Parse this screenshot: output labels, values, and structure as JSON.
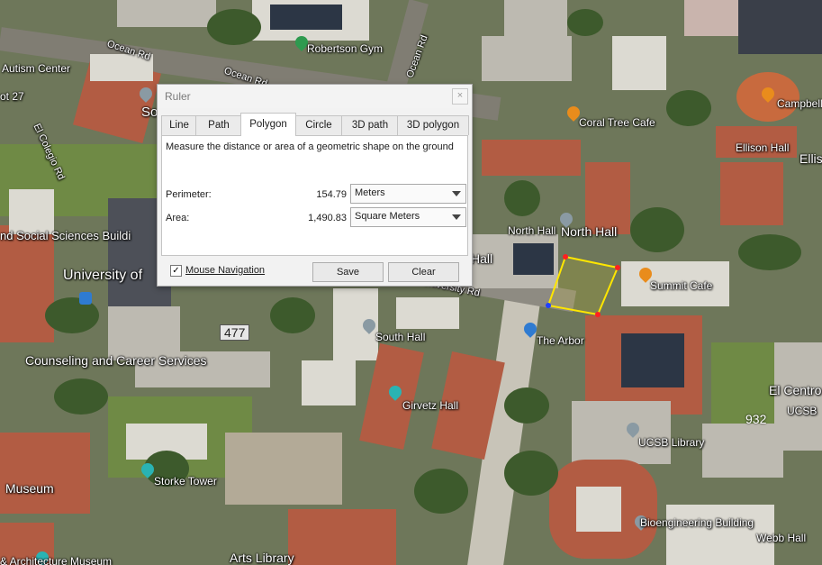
{
  "ruler": {
    "title": "Ruler",
    "close": "×",
    "tabs": [
      "Line",
      "Path",
      "Polygon",
      "Circle",
      "3D path",
      "3D polygon"
    ],
    "active_tab": "Polygon",
    "description": "Measure the distance or area of a geometric shape on the ground",
    "perimeter_label": "Perimeter:",
    "perimeter_value": "154.79",
    "perimeter_unit": "Meters",
    "area_label": "Area:",
    "area_value": "1,490.83",
    "area_unit": "Square Meters",
    "mouse_navigation_label": "Mouse Navigation",
    "mouse_navigation_checked": true,
    "save_label": "Save",
    "clear_label": "Clear"
  },
  "map": {
    "labels": {
      "robertson_gym": "Robertson Gym",
      "autism_center": "Autism Center",
      "ot27": "ot 27",
      "el_colegio": "El Colegio Rd",
      "ocean_rd_1": "Ocean Rd",
      "ocean_rd_2": "Ocean Rd",
      "ocean_rd_3": "Ocean Rd",
      "coral_tree": "Coral Tree Cafe",
      "campbell": "Campbell",
      "ellison": "Ellison Hall",
      "ellis": "Ellis",
      "north_hall_1": "North Hall",
      "north_hall_2": "North Hall",
      "hall": "Hall",
      "social_sciences": "nd Social Sciences Buildi",
      "university_of": "University of",
      "university_rd": "University Rd",
      "summit_cafe": "Summit Cafe",
      "road_477": "477",
      "south_hall": "South Hall",
      "the_arbor": "The Arbor",
      "counseling": "Counseling and Career Services",
      "el_centro": "El Centro",
      "ucsb": "UCSB",
      "road_932": "932",
      "girvetz": "Girvetz Hall",
      "ucsb_library": "UCSB Library",
      "museum": "Museum",
      "storke": "Storke Tower",
      "bioengineering": "Bioengineering Building",
      "webb": "Webb Hall",
      "arts_library": "Arts Library",
      "architecture": "& Architecture Museum",
      "so": "So"
    },
    "polygon_color": "#ffe600"
  }
}
